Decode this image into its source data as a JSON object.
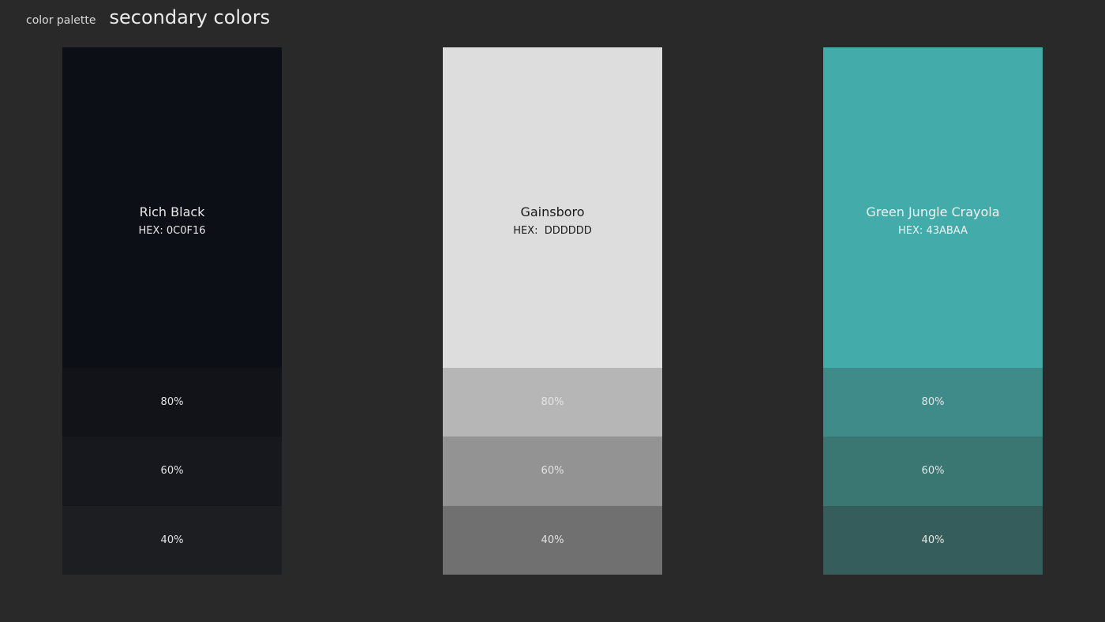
{
  "header": {
    "subtitle": "color palette",
    "title": "secondary colors"
  },
  "swatches": [
    {
      "name": "Rich Black",
      "hex_label": "HEX: 0C0F16",
      "color": "#0C0F16",
      "text_color": "#e8e8e8",
      "tints": [
        {
          "label": "80%",
          "color": "#111318"
        },
        {
          "label": "60%",
          "color": "#17181d"
        },
        {
          "label": "40%",
          "color": "#1d1e22"
        }
      ]
    },
    {
      "name": "Gainsboro",
      "hex_label": "HEX:  DDDDDD",
      "color": "#DDDDDD",
      "text_color": "#1a1a1a",
      "tints": [
        {
          "label": "80%",
          "color": "#b6b6b6"
        },
        {
          "label": "60%",
          "color": "#939393"
        },
        {
          "label": "40%",
          "color": "#707070"
        }
      ]
    },
    {
      "name": "Green Jungle Crayola",
      "hex_label": "HEX: 43ABAA",
      "color": "#43ABAA",
      "text_color": "#f2f2f2",
      "tints": [
        {
          "label": "80%",
          "color": "#3f8b8a"
        },
        {
          "label": "60%",
          "color": "#3a7672"
        },
        {
          "label": "40%",
          "color": "#345d5b"
        }
      ]
    }
  ]
}
